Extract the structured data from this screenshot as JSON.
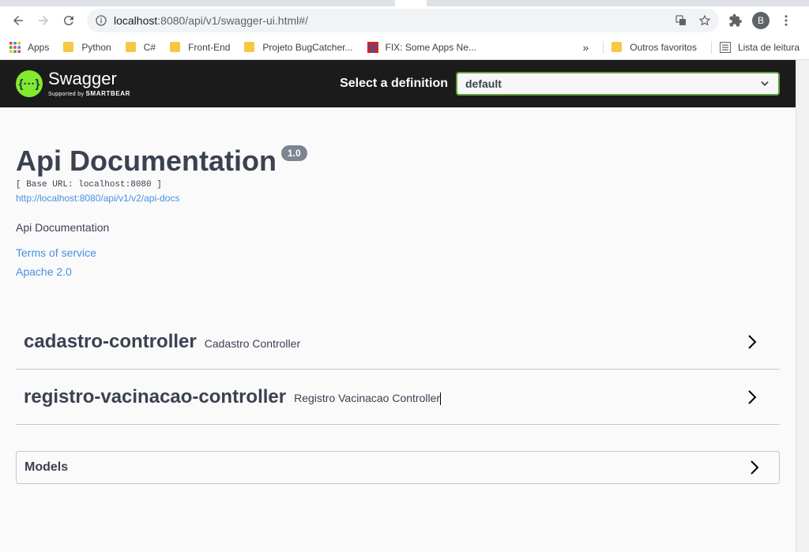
{
  "browser": {
    "url_host": "localhost",
    "url_rest": ":8080/api/v1/swagger-ui.html#/",
    "profile_initial": "B"
  },
  "bookmarks": {
    "items": [
      {
        "label": "Apps",
        "icon": "apps-grid-icon"
      },
      {
        "label": "Python",
        "icon": "folder-icon"
      },
      {
        "label": "C#",
        "icon": "folder-icon"
      },
      {
        "label": "Front-End",
        "icon": "folder-icon"
      },
      {
        "label": "Projeto BugCatcher...",
        "icon": "folder-icon"
      },
      {
        "label": "FIX: Some Apps Ne...",
        "icon": "site-favicon-icon"
      }
    ],
    "overflow": "»",
    "other": "Outros favoritos",
    "reading_list": "Lista de leitura"
  },
  "swagger": {
    "logo_name": "Swagger",
    "logo_sub": "Supported by",
    "logo_brand": "SMARTBEAR",
    "select_label": "Select a definition",
    "select_value": "default"
  },
  "info": {
    "title": "Api Documentation",
    "version": "1.0",
    "base_url": "[ Base URL: localhost:8080 ]",
    "docs_url": "http://localhost:8080/api/v1/v2/api-docs",
    "description": "Api Documentation",
    "terms": "Terms of service",
    "license": "Apache 2.0"
  },
  "tags": [
    {
      "name": "cadastro-controller",
      "description": "Cadastro Controller"
    },
    {
      "name": "registro-vacinacao-controller",
      "description": "Registro Vacinacao Controller"
    }
  ],
  "models": {
    "label": "Models"
  },
  "colors": {
    "swagger_green": "#85ea2d",
    "topbar": "#1b1b1b",
    "link": "#4990e2",
    "select_border": "#62a03f"
  }
}
